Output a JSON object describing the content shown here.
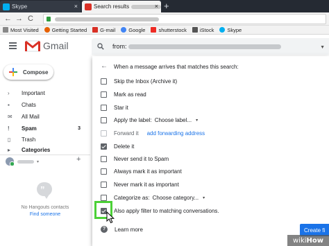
{
  "browser": {
    "tabs": [
      {
        "title": "Skype",
        "favicon_color": "#00aff0",
        "active": false
      },
      {
        "title": "Search results",
        "favicon_color": "#d93025",
        "active": true
      }
    ],
    "close_glyph": "×",
    "new_tab_glyph": "+",
    "nav": {
      "back": "←",
      "forward": "→",
      "reload": "C"
    },
    "bookmarks": [
      {
        "label": "Most Visited",
        "icon_color": "#888888"
      },
      {
        "label": "Getting Started",
        "icon_color": "#e66000"
      },
      {
        "label": "G-mail",
        "icon_color": "#d93025"
      },
      {
        "label": "Google",
        "icon_color": "#4285f4"
      },
      {
        "label": "shutterstock",
        "icon_color": "#ee2b24"
      },
      {
        "label": "iStock",
        "icon_color": "#555555"
      },
      {
        "label": "Skype",
        "icon_color": "#00aff0"
      }
    ]
  },
  "gmail": {
    "app_name": "Gmail",
    "search_prefix": "from:",
    "compose_label": "Compose",
    "nav": [
      {
        "label": "Important",
        "icon": "›",
        "count": ""
      },
      {
        "label": "Chats",
        "icon": "▪",
        "count": ""
      },
      {
        "label": "All Mail",
        "icon": "✉",
        "count": ""
      },
      {
        "label": "Spam",
        "icon": "!",
        "count": "3",
        "bold": true
      },
      {
        "label": "Trash",
        "icon": "▯",
        "count": ""
      },
      {
        "label": "Categories",
        "icon": "▸",
        "count": "",
        "bold": true
      }
    ],
    "user_add": "+",
    "hangouts_empty": "No Hangouts contacts",
    "hangouts_link": "Find someone"
  },
  "filter": {
    "back_glyph": "←",
    "heading": "When a message arrives that matches this search:",
    "options": [
      {
        "label": "Skip the Inbox (Archive it)",
        "checked": false
      },
      {
        "label": "Mark as read",
        "checked": false
      },
      {
        "label": "Star it",
        "checked": false
      },
      {
        "label": "Apply the label:",
        "checked": false,
        "select": "Choose label...",
        "caret": "▾"
      },
      {
        "label": "Forward it",
        "checked": false,
        "disabled": true,
        "link": "add forwarding address"
      },
      {
        "label": "Delete it",
        "checked": true
      },
      {
        "label": "Never send it to Spam",
        "checked": false
      },
      {
        "label": "Always mark it as important",
        "checked": false
      },
      {
        "label": "Never mark it as important",
        "checked": false
      },
      {
        "label": "Categorize as:",
        "checked": false,
        "select": "Choose category...",
        "caret": "▾"
      },
      {
        "label": "Also apply filter to matching conversations.",
        "checked": true
      }
    ],
    "learn_more": "Learn more",
    "help_glyph": "?",
    "create_button": "Create fi"
  },
  "watermark": {
    "prefix": "wiki",
    "brand": "How"
  },
  "colors": {
    "highlight": "#4cd137",
    "primary": "#1a73e8",
    "gmail_red": "#d93025"
  }
}
